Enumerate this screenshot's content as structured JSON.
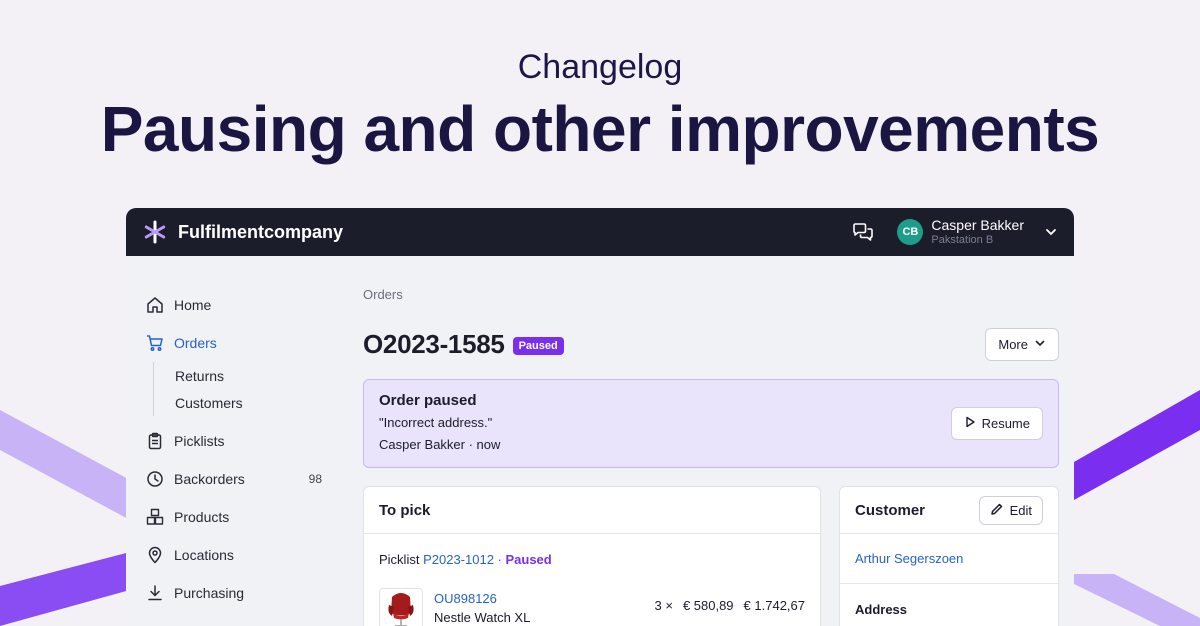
{
  "hero": {
    "subtitle": "Changelog",
    "title": "Pausing and other improvements"
  },
  "colors": {
    "accent_purple": "#7a2ff0",
    "link_blue": "#2563c9",
    "topbar": "#1c1d2b",
    "avatar": "#1e9e8a",
    "banner_bg": "#e9e3fb"
  },
  "topbar": {
    "brand": "Fulfilmentcompany",
    "brand_icon": "asterisk-logo-icon",
    "chat_icon": "chat-bubbles-icon",
    "user": {
      "initials": "CB",
      "name": "Casper Bakker",
      "role": "Pakstation B"
    }
  },
  "sidebar": {
    "items": [
      {
        "label": "Home",
        "icon": "home-icon"
      },
      {
        "label": "Orders",
        "icon": "cart-icon"
      },
      {
        "label": "Picklists",
        "icon": "clipboard-icon"
      },
      {
        "label": "Backorders",
        "icon": "clock-icon",
        "count": "98"
      },
      {
        "label": "Products",
        "icon": "boxes-icon"
      },
      {
        "label": "Locations",
        "icon": "location-pin-icon"
      },
      {
        "label": "Purchasing",
        "icon": "download-icon"
      }
    ],
    "orders_sub": [
      "Returns",
      "Customers"
    ]
  },
  "main": {
    "breadcrumb": "Orders",
    "order_id": "O2023-1585",
    "status_badge": "Paused",
    "more_label": "More",
    "banner": {
      "title": "Order paused",
      "reason": "\"Incorrect address.\"",
      "meta": "Casper Bakker · now",
      "resume_label": "Resume"
    },
    "to_pick": {
      "title": "To pick",
      "picklist_label": "Picklist",
      "picklist_id": "P2023-1012",
      "separator": " · ",
      "picklist_status": "Paused",
      "product": {
        "sku": "OU898126",
        "name": "Nestle Watch XL",
        "qty": "3 ×",
        "unit_price": "€ 580,89",
        "total": "€ 1.742,67"
      }
    },
    "customer": {
      "title": "Customer",
      "edit_label": "Edit",
      "name": "Arthur Segerszoen",
      "address_label": "Address"
    }
  }
}
